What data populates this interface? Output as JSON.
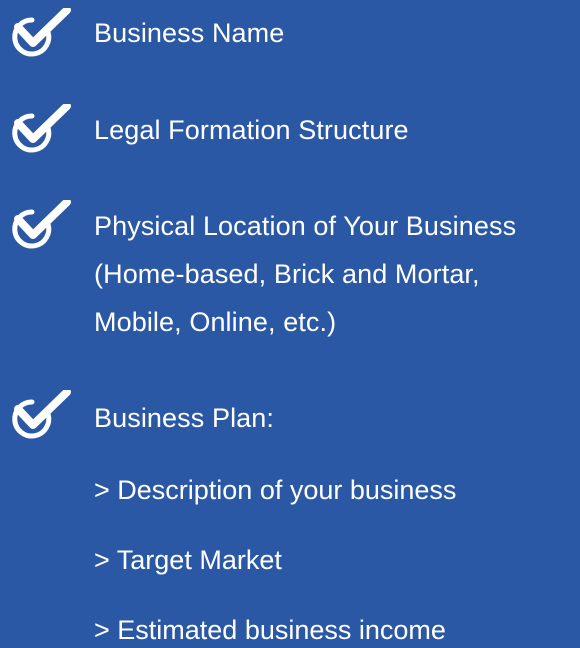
{
  "checklist": {
    "items": [
      {
        "icon": "check-circle-icon",
        "label": "Business Name"
      },
      {
        "icon": "check-circle-icon",
        "label": "Legal Formation Structure"
      },
      {
        "icon": "check-circle-icon",
        "label": "Physical Location of Your Business\n(Home-based, Brick and Mortar,\nMobile, Online, etc.)"
      },
      {
        "icon": "check-circle-icon",
        "label": "Business Plan:"
      }
    ],
    "business_plan_subitems": [
      "> Description of your business",
      "> Target Market",
      "> Estimated business income"
    ]
  },
  "colors": {
    "background": "#2b58a5",
    "text": "#ffffff"
  }
}
